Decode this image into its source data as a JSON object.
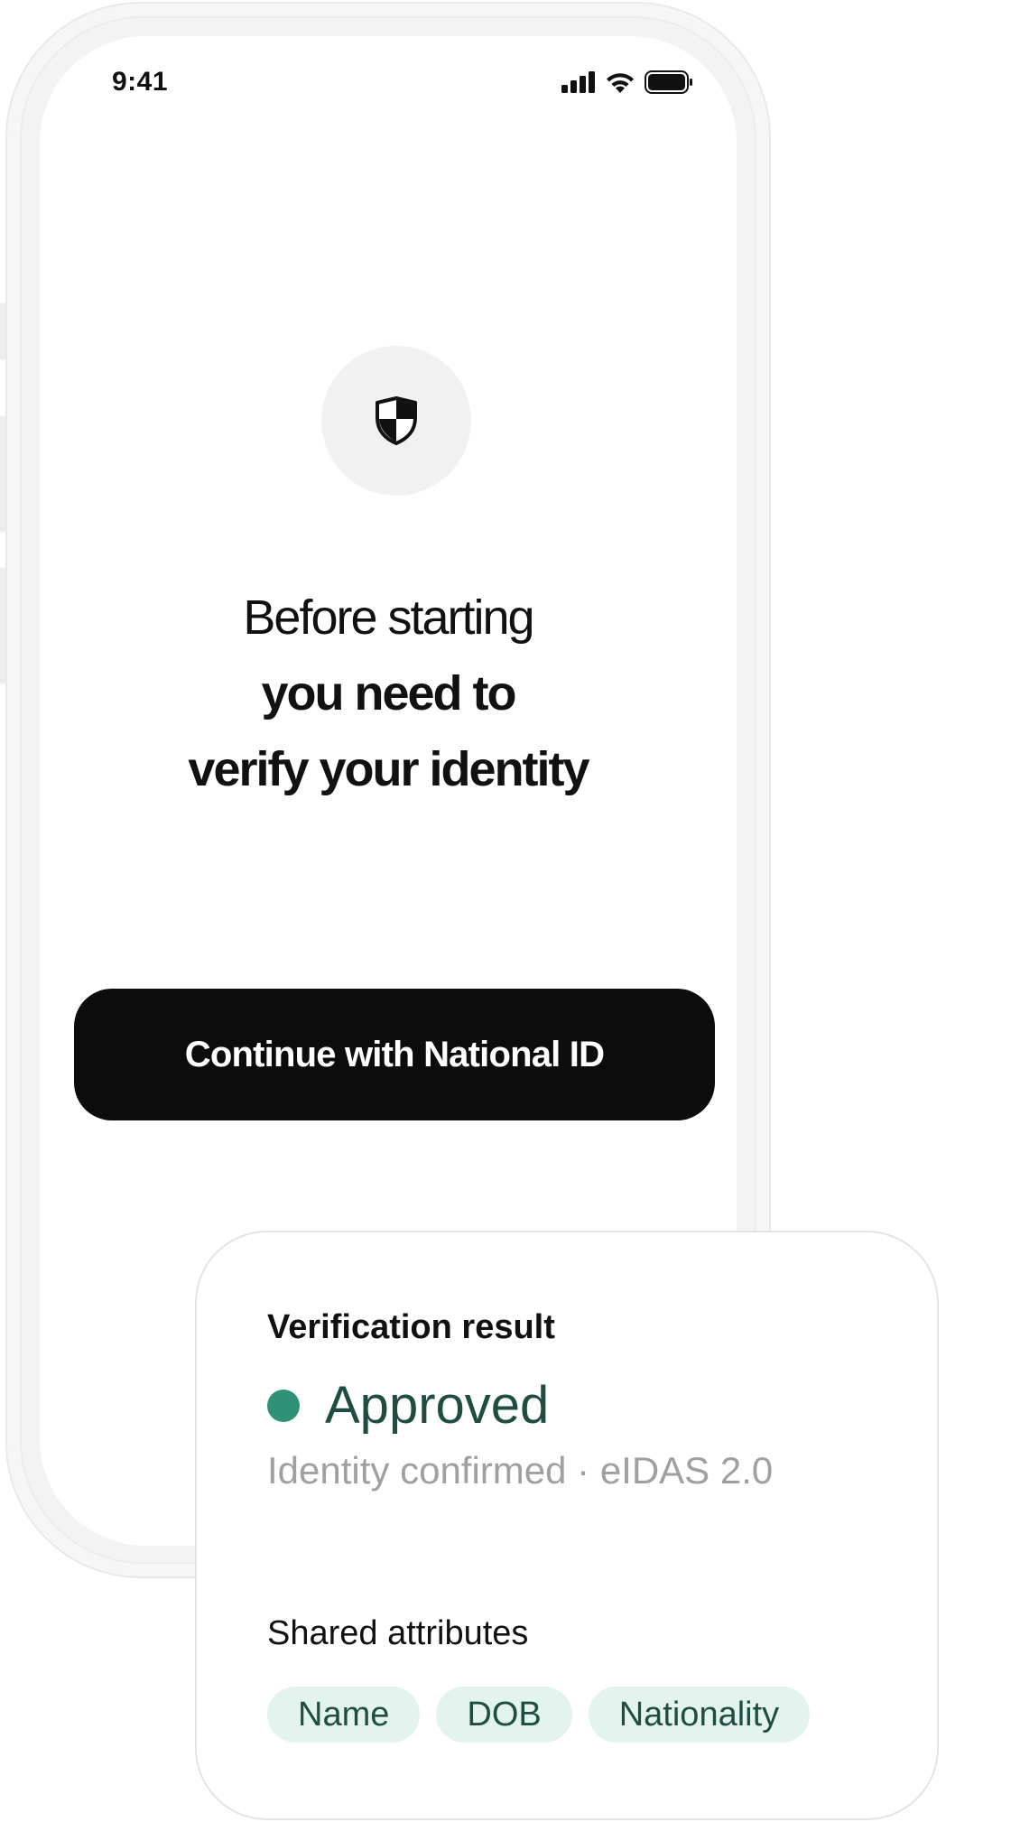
{
  "status_bar": {
    "time": "9:41",
    "icons": [
      "cellular-signal-icon",
      "wifi-icon",
      "battery-icon"
    ]
  },
  "hero": {
    "icon": "shield-icon",
    "headline_line1": "Before starting",
    "headline_line2": "you need to",
    "headline_line3": "verify your identity"
  },
  "cta": {
    "label": "Continue with National ID"
  },
  "result_card": {
    "title": "Verification result",
    "status": "Approved",
    "status_color": "#2f9276",
    "subtitle": "Identity confirmed · eIDAS 2.0",
    "attributes_title": "Shared attributes",
    "attributes": [
      "Name",
      "DOB",
      "Nationality"
    ]
  }
}
